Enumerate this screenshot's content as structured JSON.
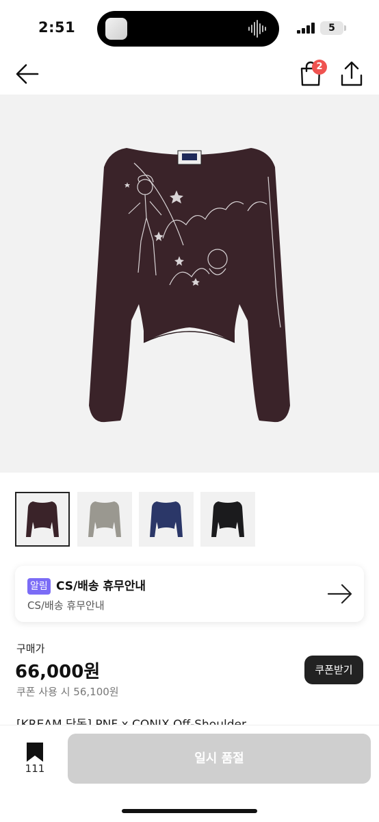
{
  "status_bar": {
    "time": "2:51",
    "battery": "5"
  },
  "nav": {
    "cart_badge": "2",
    "icons": [
      "back-arrow-icon",
      "shopping-bag-icon",
      "share-icon"
    ]
  },
  "product": {
    "colors": {
      "main": "#3a2329",
      "gray": "#9a9890",
      "navy": "#2b3768",
      "black": "#1b1b1d",
      "print": "#d9d4d6"
    },
    "thumbnails": [
      "burgundy",
      "gray",
      "navy",
      "black"
    ],
    "selected_thumbnail": 0
  },
  "notice": {
    "badge": "알림",
    "title": "CS/배송 휴무안내",
    "subtitle": "CS/배송 휴무안내"
  },
  "price": {
    "label": "구매가",
    "value": "66,000원",
    "coupon_price": "쿠폰 사용 시 56,100원",
    "coupon_button": "쿠폰받기"
  },
  "product_title": "[KREAM 단독] PNF x CONIX Off-Shoulder...",
  "bottom": {
    "bookmark_count": "111",
    "soldout_label": "일시 품절"
  },
  "accent_colors": {
    "badge_red": "#ef5350",
    "notice_purple": "#7b6cf6",
    "button_dark": "#222222",
    "disabled_gray": "#cfcfcf"
  }
}
